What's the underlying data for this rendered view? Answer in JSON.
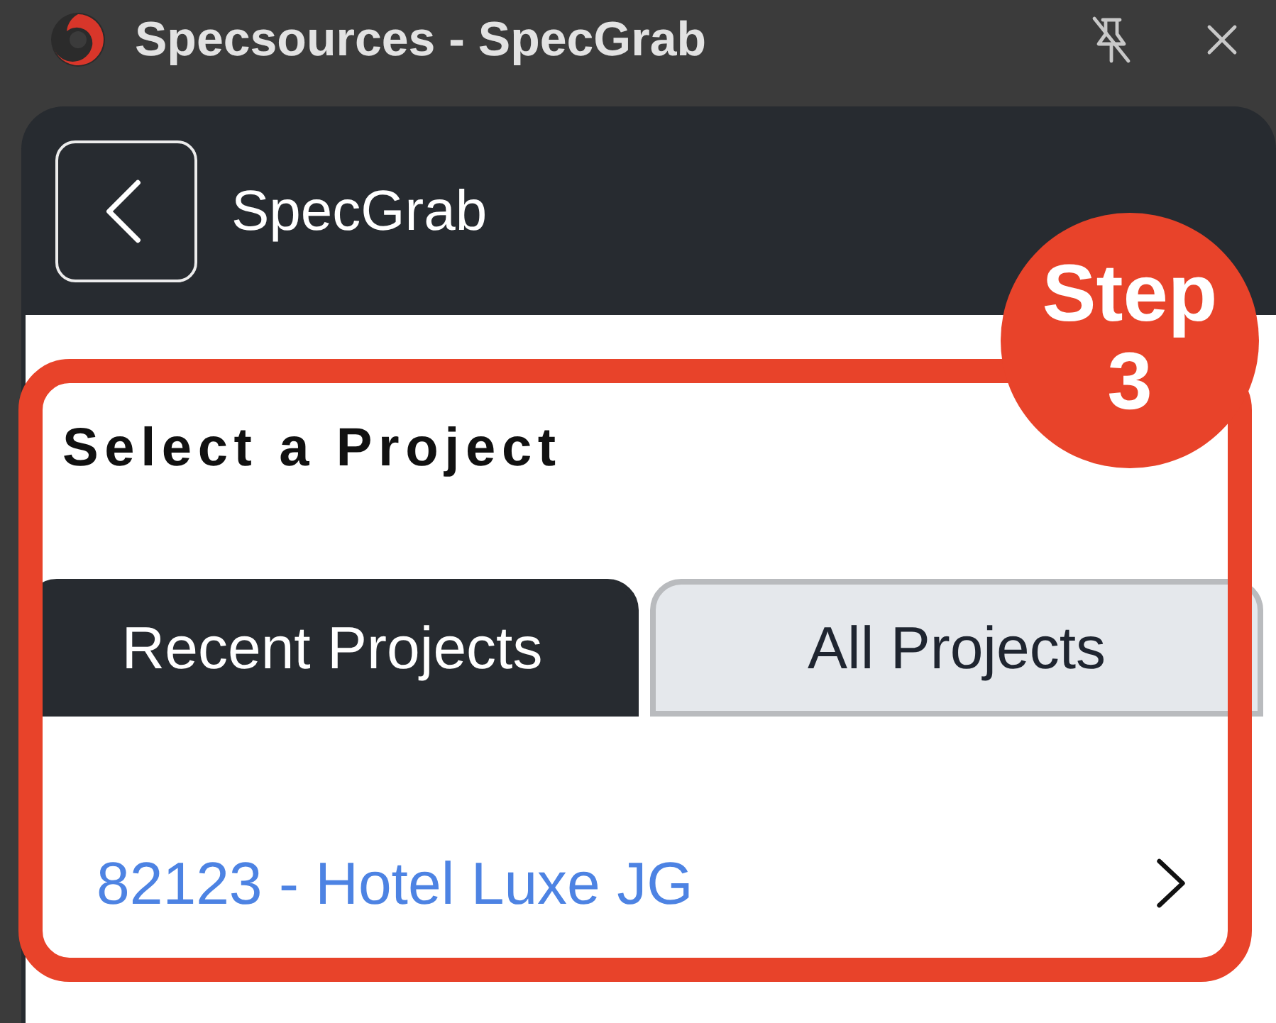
{
  "window": {
    "title": "Specsources - SpecGrab"
  },
  "header": {
    "title": "SpecGrab"
  },
  "page": {
    "heading": "Select a Project"
  },
  "tabs": [
    {
      "label": "Recent Projects",
      "selected": true
    },
    {
      "label": "All Projects",
      "selected": false
    }
  ],
  "projects": [
    {
      "label": "82123 - Hotel Luxe JG"
    }
  ],
  "annotation": {
    "badge": "Step 3"
  }
}
